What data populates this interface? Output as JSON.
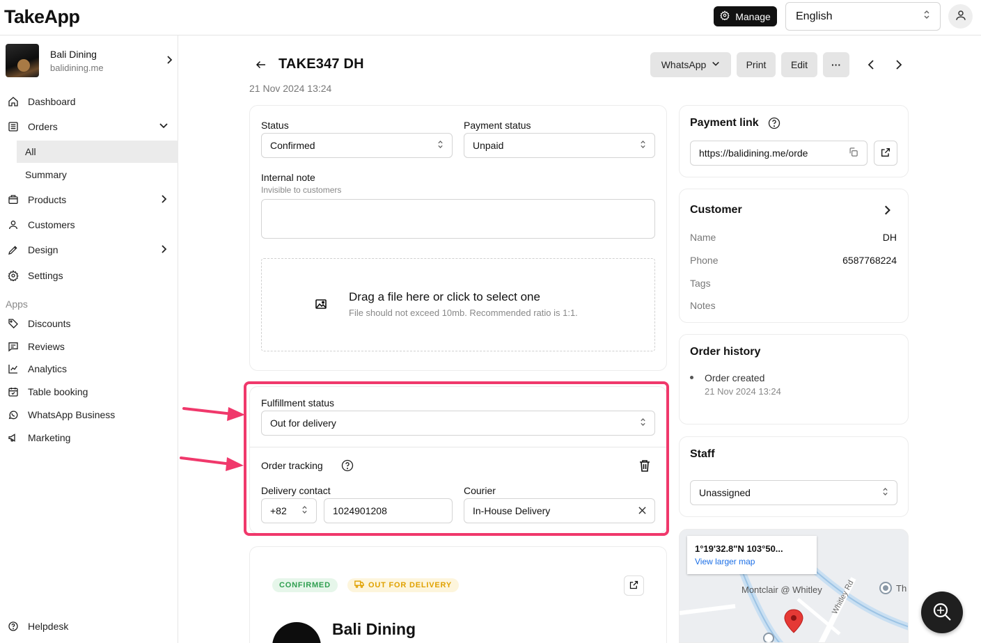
{
  "app": {
    "logo": "TakeApp"
  },
  "topbar": {
    "manage_label": "Manage",
    "language": "English"
  },
  "sidebar": {
    "store_name": "Bali Dining",
    "store_domain": "balidining.me",
    "nav": {
      "dashboard": "Dashboard",
      "orders": "Orders",
      "orders_all": "All",
      "orders_summary": "Summary",
      "products": "Products",
      "customers": "Customers",
      "design": "Design",
      "settings": "Settings"
    },
    "apps_label": "Apps",
    "apps": {
      "discounts": "Discounts",
      "reviews": "Reviews",
      "analytics": "Analytics",
      "table_booking": "Table booking",
      "whatsapp_business": "WhatsApp Business",
      "marketing": "Marketing"
    },
    "helpdesk": "Helpdesk"
  },
  "order": {
    "id": "TAKE347",
    "customer_initials": "DH",
    "date": "21 Nov 2024 13:24",
    "actions": {
      "whatsapp": "WhatsApp",
      "print": "Print",
      "edit": "Edit",
      "more": "···"
    }
  },
  "status_card": {
    "status_label": "Status",
    "status_value": "Confirmed",
    "payment_label": "Payment status",
    "payment_value": "Unpaid",
    "note_label": "Internal note",
    "note_sub": "Invisible to customers",
    "drop_title": "Drag a file here or click to select one",
    "drop_sub": "File should not exceed 10mb. Recommended ratio is 1:1."
  },
  "fulfillment": {
    "label": "Fulfillment status",
    "value": "Out for delivery",
    "tracking_label": "Order tracking",
    "contact_label": "Delivery contact",
    "country_code": "+82",
    "phone": "1024901208",
    "courier_label": "Courier",
    "courier_value": "In-House Delivery"
  },
  "preview": {
    "badge_confirmed": "CONFIRMED",
    "badge_delivery": "OUT FOR DELIVERY",
    "store_name": "Bali Dining"
  },
  "payment_link": {
    "title": "Payment link",
    "url": "https://balidining.me/orde"
  },
  "customer": {
    "title": "Customer",
    "name_label": "Name",
    "name_value": "DH",
    "phone_label": "Phone",
    "phone_value": "6587768224",
    "tags_label": "Tags",
    "notes_label": "Notes"
  },
  "history": {
    "title": "Order history",
    "event": "Order created",
    "event_date": "21 Nov 2024 13:24"
  },
  "staff": {
    "title": "Staff",
    "value": "Unassigned"
  },
  "map": {
    "coords": "1°19'32.8\"N 103°50...",
    "link": "View larger map",
    "place": "Montclair @ Whitley",
    "road": "Whitley Rd",
    "edge_label": "Th"
  },
  "colors": {
    "highlight": "#f0386b",
    "confirmed_text": "#2e9e4f",
    "delivery_text": "#e0a100"
  }
}
